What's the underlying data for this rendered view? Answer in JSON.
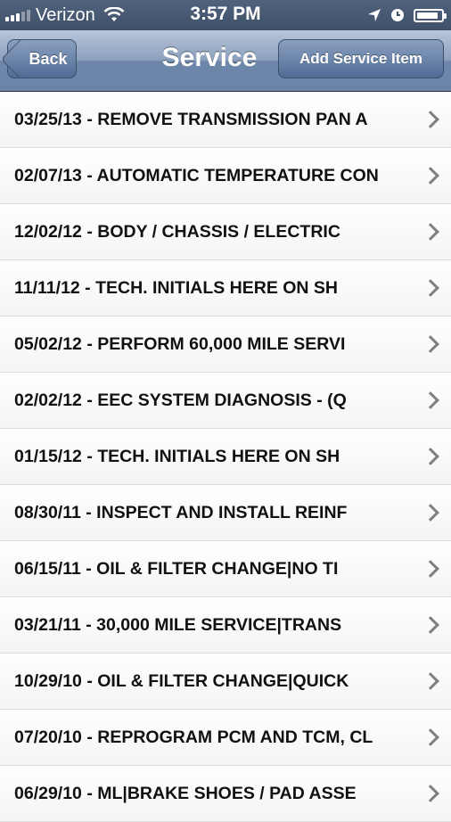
{
  "status_bar": {
    "carrier": "Verizon",
    "time": "3:57 PM",
    "icons": [
      "signal-icon",
      "wifi-icon",
      "location-icon",
      "alarm-icon",
      "battery-icon"
    ],
    "battery_level": 0.9
  },
  "nav": {
    "back_label": "Back",
    "title": "Service",
    "add_label": "Add Service Item"
  },
  "items": [
    {
      "text": "03/25/13 - REMOVE TRANSMISSION PAN A"
    },
    {
      "text": "02/07/13 - AUTOMATIC TEMPERATURE CON"
    },
    {
      "text": "12/02/12 - BODY / CHASSIS / ELECTRIC"
    },
    {
      "text": "11/11/12 - TECH. INITIALS HERE ON SH"
    },
    {
      "text": "05/02/12 - PERFORM 60,000 MILE SERVI"
    },
    {
      "text": "02/02/12 - EEC SYSTEM DIAGNOSIS - (Q"
    },
    {
      "text": "01/15/12 - TECH. INITIALS HERE ON SH"
    },
    {
      "text": "08/30/11 - INSPECT AND INSTALL REINF"
    },
    {
      "text": "06/15/11 - OIL & FILTER CHANGE|NO TI"
    },
    {
      "text": "03/21/11 - 30,000 MILE SERVICE|TRANS"
    },
    {
      "text": "10/29/10 - OIL & FILTER CHANGE|QUICK"
    },
    {
      "text": "07/20/10 - REPROGRAM PCM AND TCM, CL"
    },
    {
      "text": "06/29/10 - ML|BRAKE SHOES / PAD ASSE"
    }
  ]
}
